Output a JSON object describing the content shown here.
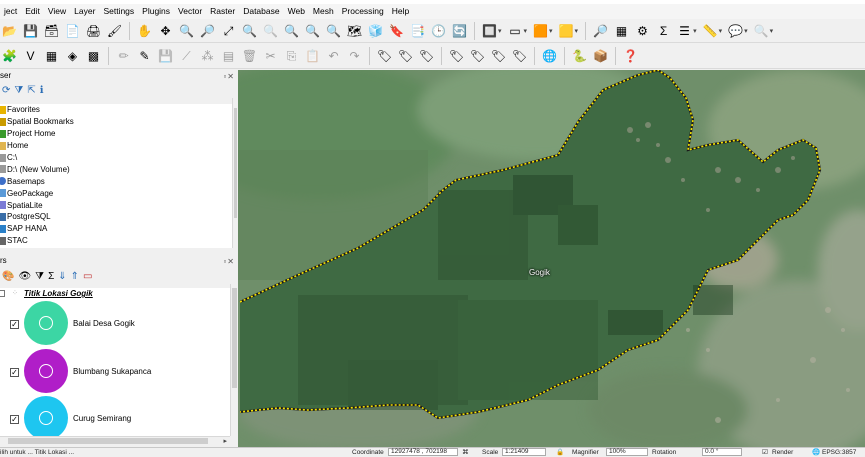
{
  "menu": [
    "ject",
    "Edit",
    "View",
    "Layer",
    "Settings",
    "Plugins",
    "Vector",
    "Raster",
    "Database",
    "Web",
    "Mesh",
    "Processing",
    "Help"
  ],
  "browser_panel": {
    "title": "ser",
    "items": [
      {
        "label": "Favorites",
        "icon": "star-icon",
        "color": "#e8b400"
      },
      {
        "label": "Spatial Bookmarks",
        "icon": "bookmark-icon",
        "color": "#c99b00"
      },
      {
        "label": "Project Home",
        "icon": "home-folder-icon",
        "color": "#3a9a2c"
      },
      {
        "label": "Home",
        "icon": "folder-icon",
        "color": "#e0b550"
      },
      {
        "label": "C:\\",
        "icon": "drive-icon",
        "color": "#9a9a9a"
      },
      {
        "label": "D:\\ (New Volume)",
        "icon": "drive-icon",
        "color": "#9a9a9a"
      },
      {
        "label": "Basemaps",
        "icon": "globe-icon",
        "color": "#3d6fc8"
      },
      {
        "label": "GeoPackage",
        "icon": "geopackage-icon",
        "color": "#5a9ad8"
      },
      {
        "label": "SpatiaLite",
        "icon": "spatialite-icon",
        "color": "#7b7bd6"
      },
      {
        "label": "PostgreSQL",
        "icon": "postgres-icon",
        "color": "#3a6ea8"
      },
      {
        "label": "SAP HANA",
        "icon": "database-icon",
        "color": "#2a80c8"
      },
      {
        "label": "STAC",
        "icon": "stac-icon",
        "color": "#666666"
      }
    ]
  },
  "layers_panel": {
    "title": "rs",
    "group_layer": "Titik Lokasi Gogik",
    "entries": [
      {
        "label": "Balai Desa Gogik",
        "color": "#3cd6a4",
        "checked": true
      },
      {
        "label": "Blumbang Sukapanca",
        "color": "#b01ec8",
        "checked": true
      },
      {
        "label": "Curug Semirang",
        "color": "#1ec6f0",
        "checked": true
      }
    ]
  },
  "map": {
    "polygon_label": "Gogik",
    "boundary_color": "#f5e400"
  },
  "statusbar": {
    "left_text": "ilih untuk ... Titik Lokasi ...",
    "coordinate_label": "Coordinate",
    "coordinate_value": "12927478 , 702198",
    "scale_label": "Scale",
    "scale_value": "1:21409",
    "magnifier_label": "Magnifier",
    "magnifier_value": "100%",
    "rotation_label": "Rotation",
    "rotation_value": "0.0 °",
    "render_label": "Render",
    "crs_label": "EPSG:3857"
  }
}
